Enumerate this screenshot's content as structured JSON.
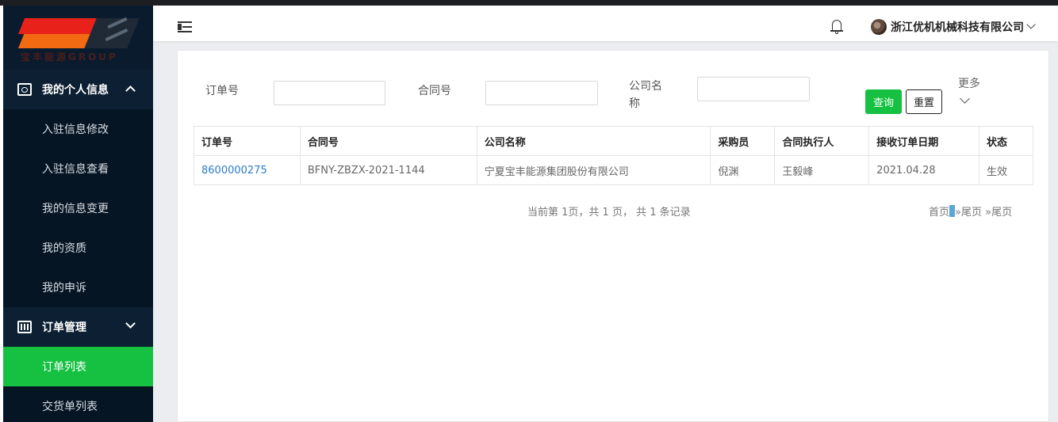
{
  "sidebar": {
    "logo_text": "宝丰能源GROUP",
    "groups": [
      {
        "label": "我的个人信息"
      },
      {
        "label": "订单管理"
      }
    ],
    "items": [
      {
        "label": "入驻信息修改"
      },
      {
        "label": "入驻信息查看"
      },
      {
        "label": "我的信息变更"
      },
      {
        "label": "我的资质"
      },
      {
        "label": "我的申诉"
      },
      {
        "label": "订单列表"
      },
      {
        "label": "交货单列表"
      }
    ]
  },
  "header": {
    "company": "浙江优机机械科技有限公司"
  },
  "filters": {
    "order_no_label": "订单号",
    "contract_no_label": "合同号",
    "company_label_1": "公司名",
    "company_label_2": "称",
    "query_button": "查询",
    "reset_button": "重置",
    "more_label": "更多"
  },
  "table": {
    "headers": [
      "订单号",
      "合同号",
      "公司名称",
      "采购员",
      "合同执行人",
      "接收订单日期",
      "状态"
    ],
    "rows": [
      [
        "8600000275",
        "BFNY-ZBZX-2021-1144",
        "宁夏宝丰能源集团股份有限公司",
        "倪渊",
        "王毅峰",
        "2021.04.28",
        "生效"
      ]
    ]
  },
  "pagination": {
    "summary": "当前第 1页，共 1 页， 共 1 条记录",
    "first": "首页",
    "current": "1",
    "next_last": "»尾页",
    "last": "»尾页"
  },
  "colors": {
    "sidebar_bg": "#0c1f33",
    "active_green": "#16c142",
    "link_blue": "#2a7bc8"
  }
}
